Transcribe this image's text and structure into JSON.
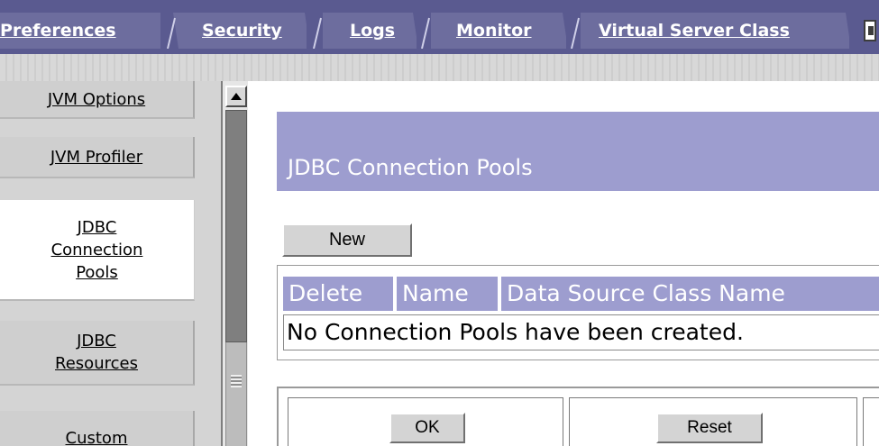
{
  "tabs": [
    {
      "label": "Preferences"
    },
    {
      "label": "Security"
    },
    {
      "label": "Logs"
    },
    {
      "label": "Monitor"
    },
    {
      "label": "Virtual Server Class"
    }
  ],
  "nav": {
    "items": [
      {
        "label": "JVM Options"
      },
      {
        "label": "JVM Profiler"
      },
      {
        "label": "JDBC Connection Pools",
        "active": true
      },
      {
        "label": "JDBC Resources"
      },
      {
        "label": "Custom"
      }
    ]
  },
  "main": {
    "title": "JDBC Connection Pools",
    "new_button": "New",
    "table": {
      "columns": [
        "Delete",
        "Name",
        "Data Source Class Name"
      ],
      "empty_message": "No Connection Pools have been created."
    },
    "ok_button": "OK",
    "reset_button": "Reset"
  },
  "colors": {
    "tab_bar": "#5a5a90",
    "tab": "#6d6d9e",
    "header_band": "#9d9dcf",
    "nav_bg": "#d4d4d4"
  }
}
